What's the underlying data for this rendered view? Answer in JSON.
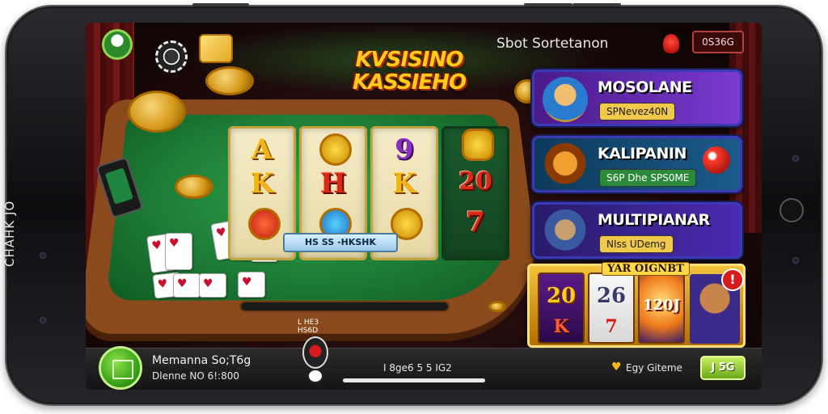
{
  "device": {
    "frame_label": "CHAHK JO"
  },
  "header": {
    "title": "Sbot Sortetanon",
    "balance": "0S36G",
    "logo_line1": "KVSISINO",
    "logo_line2": "KASSIEHO"
  },
  "reels": {
    "col1": [
      "A",
      "K"
    ],
    "col2": [
      "H"
    ],
    "col3": [
      "9",
      "K"
    ],
    "col4": [
      "20",
      "7"
    ],
    "win_strip": "HS SS -HKSHK"
  },
  "games": [
    {
      "title": "MOSOLANE",
      "button": "SPNevez40N",
      "color": "#6a2ab0"
    },
    {
      "title": "KALIPANIN",
      "button": "S6P Dhe SPS0ME",
      "color": "#1a5aa0"
    },
    {
      "title": "MULTIPIANAR",
      "button": "NIss UDemg",
      "color": "#4a2ab0"
    }
  ],
  "jackpot": {
    "title": "YAR OIGNBT",
    "reel1": "20",
    "reel1_sub": "K",
    "reel2": "26",
    "reel2_sub": "7",
    "reel3": "120J"
  },
  "bottom": {
    "player_name": "Memanna So;T6g",
    "player_sub": "Dlenne NO 6!:800",
    "small_label_1": "L HE3",
    "small_label_2": "HS6D",
    "center_text": "I 8ge6 5 5 IG2",
    "right_label": "Egy Giteme",
    "play_button": "J 5G"
  },
  "icons": {
    "avatar": "user-avatar-icon",
    "notification": "alert-icon",
    "heart": "heart-icon"
  }
}
